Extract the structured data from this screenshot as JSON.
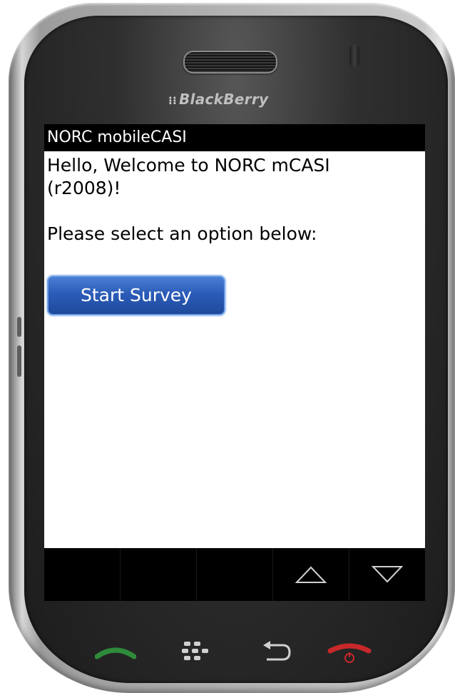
{
  "device": {
    "brand": "BlackBerry"
  },
  "app": {
    "title": "NORC mobileCASI"
  },
  "welcome": {
    "line1": "Hello, Welcome to NORC mCASI",
    "line2": "(r2008)!",
    "prompt": "Please select an option below:"
  },
  "actions": {
    "start_survey_label": "Start Survey"
  },
  "softkeys": {
    "icons": [
      "up-arrow-icon",
      "down-arrow-icon"
    ]
  },
  "hardware_keys": {
    "icons": [
      "call-icon",
      "blackberry-menu-icon",
      "back-icon",
      "end-call-icon"
    ]
  },
  "colors": {
    "button_blue": "#2b5cb8",
    "call_green": "#2e8b3a",
    "end_red": "#c8282a"
  }
}
